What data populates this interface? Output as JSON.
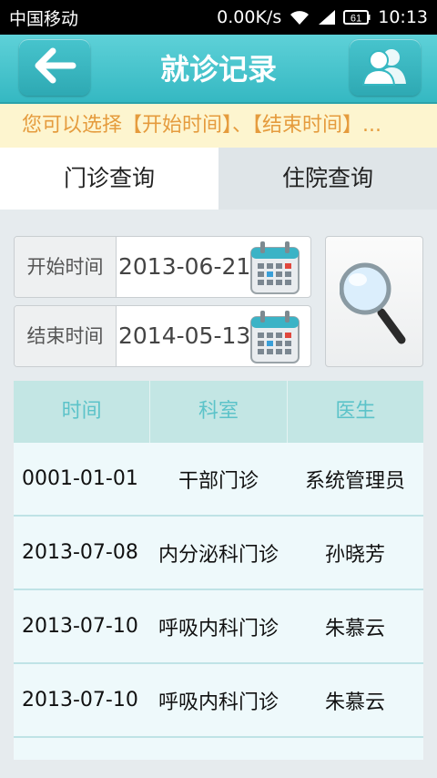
{
  "status_bar": {
    "carrier": "中国移动",
    "speed": "0.00K/s",
    "battery": "61",
    "time": "10:13",
    "icons": [
      "wifi-icon",
      "signal-icon",
      "battery-icon"
    ]
  },
  "header": {
    "title": "就诊记录",
    "back_icon": "arrow-left-icon",
    "users_icon": "users-icon",
    "accent_color": "#35b8c2"
  },
  "notice": {
    "text": "您可以选择【开始时间】、【结束时间】..."
  },
  "tabs": [
    {
      "label": "门诊查询",
      "active": true
    },
    {
      "label": "住院查询",
      "active": false
    }
  ],
  "filter": {
    "start_label": "开始时间",
    "start_value": "2013-06-21",
    "end_label": "结束时间",
    "end_value": "2014-05-13",
    "calendar_icon": "calendar-icon",
    "search_icon": "magnifier-icon"
  },
  "table": {
    "columns": [
      "时间",
      "科室",
      "医生"
    ],
    "rows": [
      [
        "0001-01-01",
        "干部门诊",
        "系统管理员"
      ],
      [
        "2013-07-08",
        "内分泌科门诊",
        "孙晓芳"
      ],
      [
        "2013-07-10",
        "呼吸内科门诊",
        "朱慕云"
      ],
      [
        "2013-07-10",
        "呼吸内科门诊",
        "朱慕云"
      ]
    ]
  }
}
